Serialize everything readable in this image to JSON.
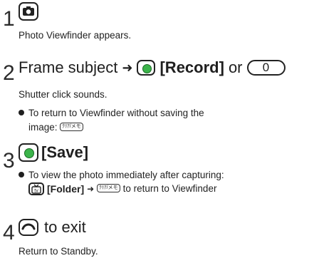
{
  "steps": [
    {
      "number": "1",
      "key_icon": "camera-icon",
      "description": "Photo Viewfinder appears."
    },
    {
      "number": "2",
      "title_prefix": "Frame subject",
      "arrow": "➜",
      "center_key_icon": "center-key-icon",
      "record_label": "[Record]",
      "or_label": "or",
      "zero_key_label": "0",
      "description": "Shutter click sounds.",
      "bullet_line1": "To return to Viewfinder without saving the",
      "bullet_line2": "image:",
      "clear_key_label": "ｸﾘｱ/メモ"
    },
    {
      "number": "3",
      "center_key_icon": "center-key-icon",
      "save_label": "[Save]",
      "bullet_line1": "To view the photo immediately after capturing:",
      "tv_key_icon": "tv-key-icon",
      "folder_label": "[Folder]",
      "arrow": "➜",
      "clear_key_label": "ｸﾘｱ/メモ",
      "bullet_line2_suffix": "to return to Viewfinder"
    },
    {
      "number": "4",
      "end_key_icon": "end-key-icon",
      "title_suffix": "to exit",
      "description": "Return to Standby."
    }
  ]
}
